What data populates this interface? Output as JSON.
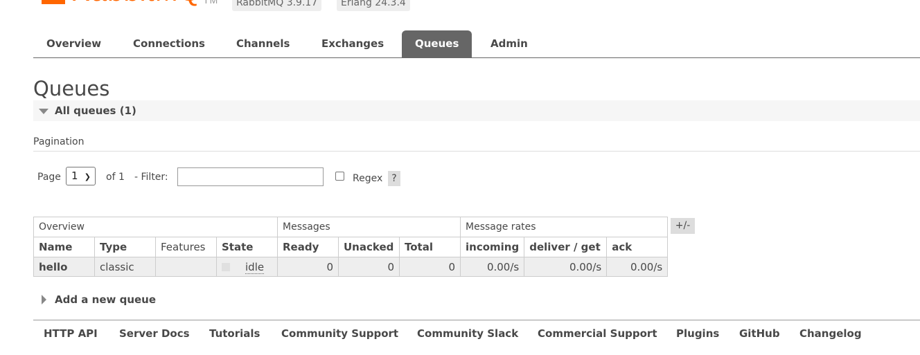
{
  "header": {
    "logo_text": "RabbitMQ",
    "tm": "TM",
    "rabbitmq_version": "RabbitMQ 3.9.17",
    "erlang_version": "Erlang 24.3.4",
    "brand_color": "#ff6600"
  },
  "nav": {
    "tabs": [
      "Overview",
      "Connections",
      "Channels",
      "Exchanges",
      "Queues",
      "Admin"
    ],
    "active": "Queues"
  },
  "page": {
    "title": "Queues",
    "section_title": "All queues (1)"
  },
  "pagination": {
    "label": "Pagination",
    "page_label": "Page",
    "page_value": "1",
    "of_label": "of 1",
    "filter_label": "- Filter:",
    "filter_value": "",
    "regex_label": "Regex",
    "help": "?"
  },
  "table": {
    "groups": [
      "Overview",
      "Messages",
      "Message rates"
    ],
    "columns": [
      "Name",
      "Type",
      "Features",
      "State",
      "Ready",
      "Unacked",
      "Total",
      "incoming",
      "deliver / get",
      "ack"
    ],
    "rows": [
      {
        "name": "hello",
        "type": "classic",
        "features": "",
        "state": "idle",
        "ready": "0",
        "unacked": "0",
        "total": "0",
        "incoming": "0.00/s",
        "deliver_get": "0.00/s",
        "ack": "0.00/s"
      }
    ],
    "columns_toggle": "+/-"
  },
  "add_queue": "Add a new queue",
  "footer": {
    "links": [
      "HTTP API",
      "Server Docs",
      "Tutorials",
      "Community Support",
      "Community Slack",
      "Commercial Support",
      "Plugins",
      "GitHub",
      "Changelog"
    ]
  }
}
